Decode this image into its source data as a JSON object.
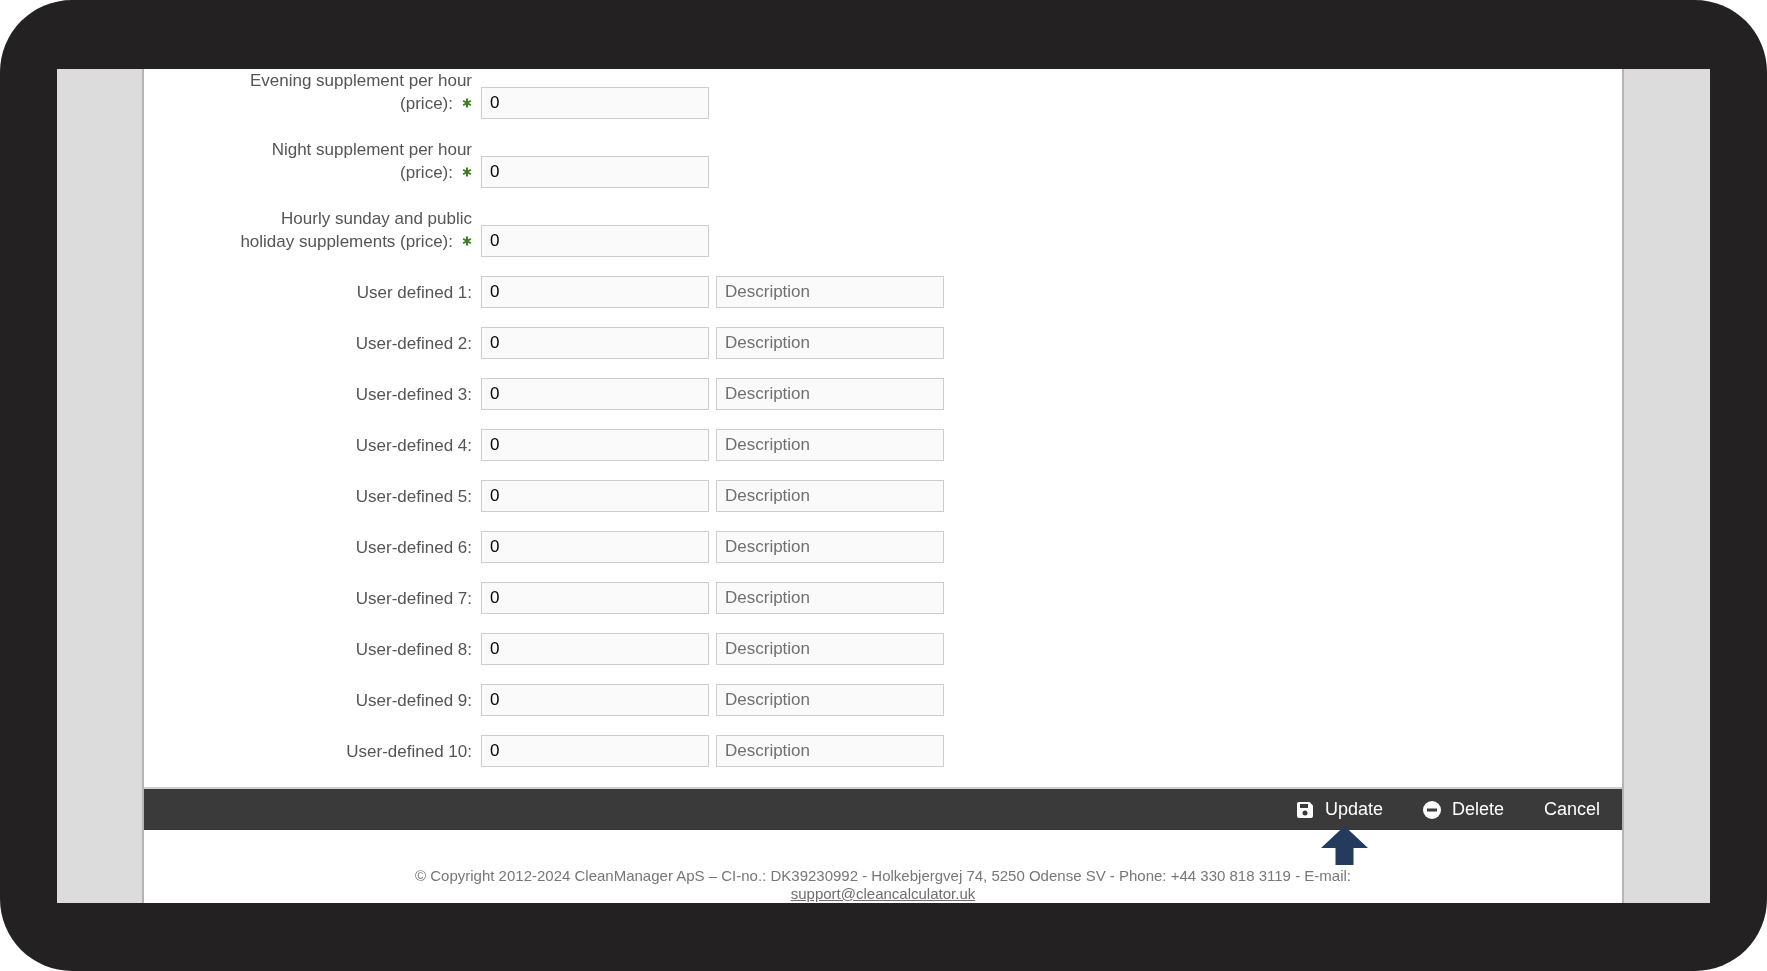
{
  "fields": [
    {
      "kind": "price",
      "label": "Evening supplement per hour (price):",
      "required": true,
      "value": "0"
    },
    {
      "kind": "price",
      "label": "Night supplement per hour (price):",
      "required": true,
      "value": "0"
    },
    {
      "kind": "price",
      "label": "Hourly sunday and public holiday supplements (price):",
      "required": true,
      "value": "0"
    },
    {
      "kind": "custom",
      "label": "User defined 1:",
      "required": false,
      "value": "0",
      "description_placeholder": "Description"
    },
    {
      "kind": "custom",
      "label": "User-defined 2:",
      "required": false,
      "value": "0",
      "description_placeholder": "Description"
    },
    {
      "kind": "custom",
      "label": "User-defined 3:",
      "required": false,
      "value": "0",
      "description_placeholder": "Description"
    },
    {
      "kind": "custom",
      "label": "User-defined 4:",
      "required": false,
      "value": "0",
      "description_placeholder": "Description"
    },
    {
      "kind": "custom",
      "label": "User-defined 5:",
      "required": false,
      "value": "0",
      "description_placeholder": "Description"
    },
    {
      "kind": "custom",
      "label": "User-defined 6:",
      "required": false,
      "value": "0",
      "description_placeholder": "Description"
    },
    {
      "kind": "custom",
      "label": "User-defined 7:",
      "required": false,
      "value": "0",
      "description_placeholder": "Description"
    },
    {
      "kind": "custom",
      "label": "User-defined 8:",
      "required": false,
      "value": "0",
      "description_placeholder": "Description"
    },
    {
      "kind": "custom",
      "label": "User-defined 9:",
      "required": false,
      "value": "0",
      "description_placeholder": "Description"
    },
    {
      "kind": "custom",
      "label": "User-defined 10:",
      "required": false,
      "value": "0",
      "description_placeholder": "Description"
    }
  ],
  "actions": [
    {
      "kind": "save",
      "label": "Update"
    },
    {
      "kind": "delete",
      "label": "Delete"
    },
    {
      "kind": "plain",
      "label": "Cancel"
    }
  ],
  "footer": {
    "text": "© Copyright 2012-2024 CleanManager ApS – CI-no.: DK39230992 - Holkebjergvej 74, 5250 Odense SV - Phone: +44 330 818 3119 - E-mail:",
    "email": "support@cleancalculator.uk"
  }
}
